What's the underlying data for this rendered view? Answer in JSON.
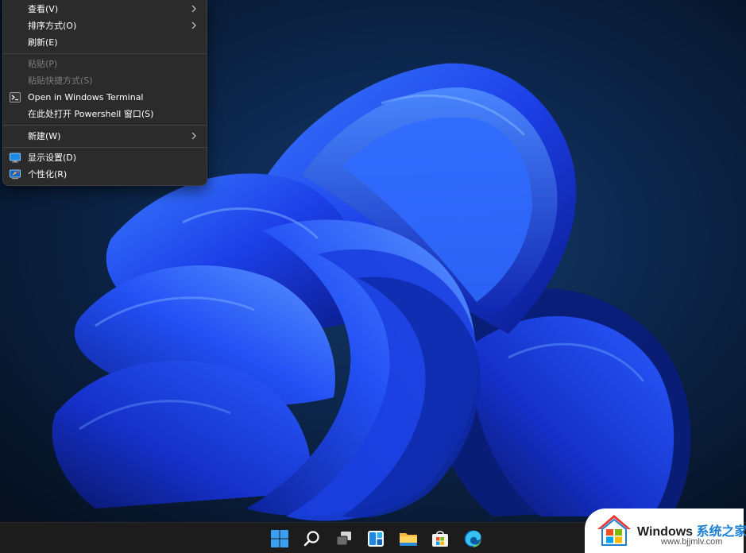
{
  "context_menu": {
    "items": [
      {
        "label": "查看(V)",
        "submenu": true,
        "disabled": false
      },
      {
        "label": "排序方式(O)",
        "submenu": true,
        "disabled": false
      },
      {
        "label": "刷新(E)",
        "submenu": false,
        "disabled": false
      },
      {
        "label": "粘贴(P)",
        "submenu": false,
        "disabled": true
      },
      {
        "label": "粘贴快捷方式(S)",
        "submenu": false,
        "disabled": true
      },
      {
        "label": "Open in Windows Terminal",
        "submenu": false,
        "disabled": false,
        "icon": "terminal-icon"
      },
      {
        "label": "在此处打开 Powershell 窗口(S)",
        "submenu": false,
        "disabled": false
      },
      {
        "label": "新建(W)",
        "submenu": true,
        "disabled": false
      },
      {
        "label": "显示设置(D)",
        "submenu": false,
        "disabled": false,
        "icon": "display-settings-icon"
      },
      {
        "label": "个性化(R)",
        "submenu": false,
        "disabled": false,
        "icon": "personalize-icon"
      }
    ]
  },
  "taskbar": {
    "icons": [
      "start-icon",
      "search-icon",
      "task-view-icon",
      "widgets-icon",
      "file-explorer-icon",
      "store-icon",
      "edge-icon"
    ]
  },
  "watermark": {
    "title_en": "Windows",
    "title_cn": "系统之家",
    "url": "www.bjjmlv.com"
  },
  "colors": {
    "menu_bg": "#2b2b2b",
    "menu_text": "#ffffff",
    "menu_disabled": "#7d7d7d",
    "taskbar_bg": "#1c1c1c",
    "wallpaper_base": "#0a1526",
    "accent_blue": "#1e4fff"
  }
}
